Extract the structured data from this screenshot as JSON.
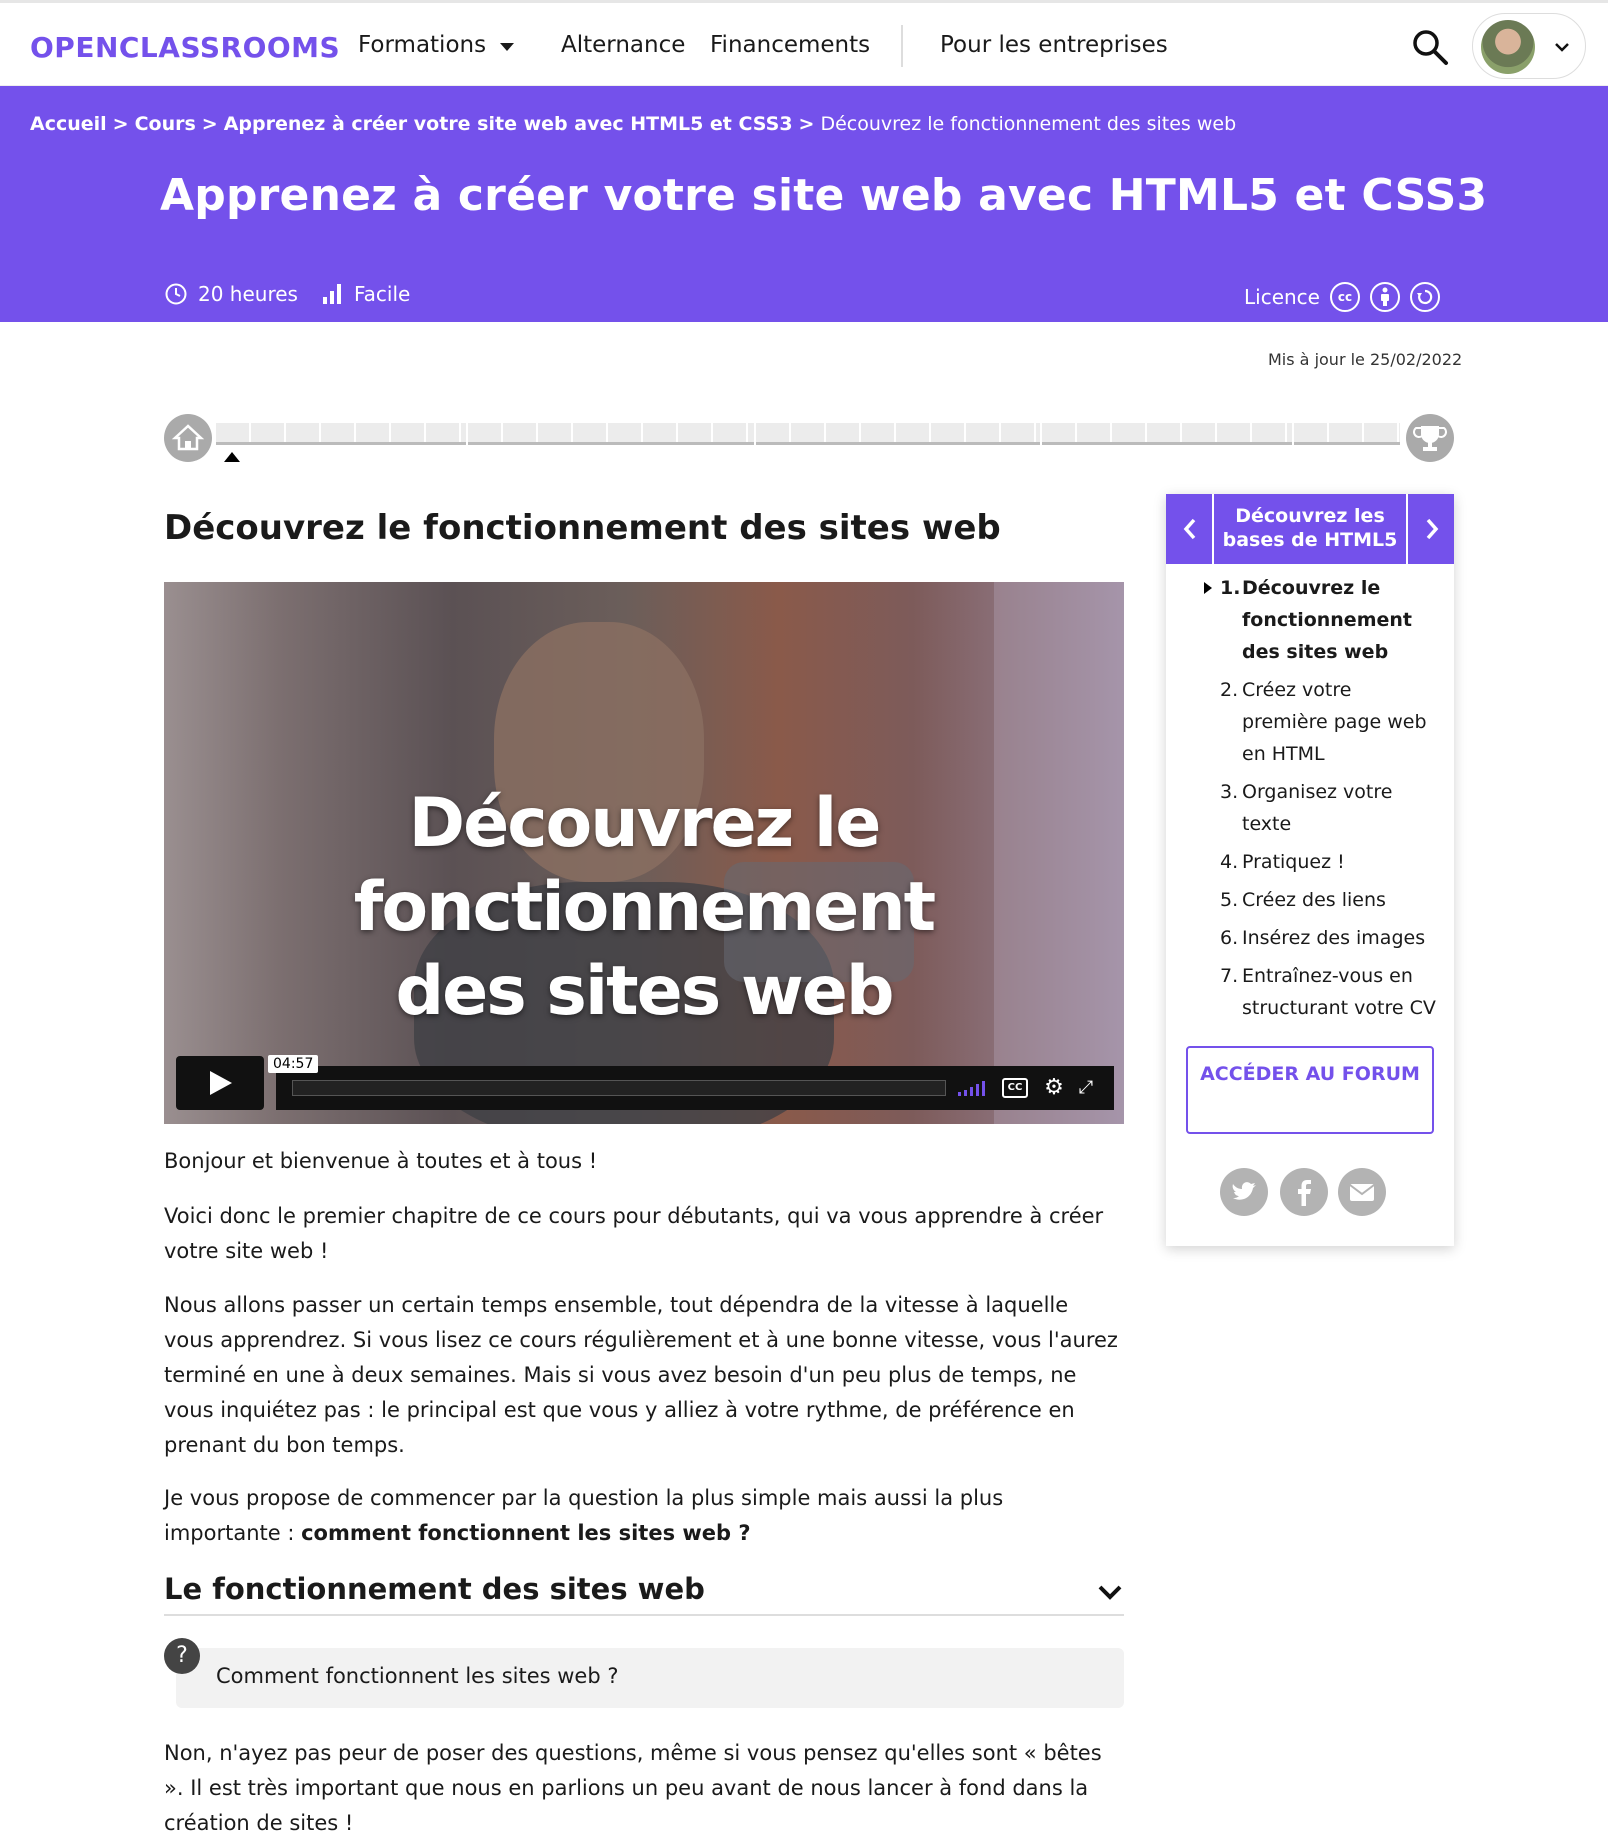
{
  "header": {
    "logo": "OPENCLASSROOMS",
    "nav": {
      "formations": "Formations",
      "alternance": "Alternance",
      "financements": "Financements",
      "entreprises": "Pour les entreprises"
    }
  },
  "hero": {
    "breadcrumb": {
      "home": "Accueil",
      "courses": "Cours",
      "course": "Apprenez à créer votre site web avec HTML5 et CSS3",
      "chapter": "Découvrez le fonctionnement des sites web",
      "separator": ">"
    },
    "title": "Apprenez à créer votre site web avec HTML5 et CSS3",
    "duration": "20 heures",
    "level": "Facile",
    "licence_label": "Licence",
    "licence_icons": [
      "cc",
      "by",
      "sa"
    ]
  },
  "updated": "Mis à jour le 25/02/2022",
  "progress": {
    "current_chapter_index": 0
  },
  "chapter": {
    "title": "Découvrez le fonctionnement des sites web",
    "video": {
      "overlay_title_line1": "Découvrez le fonctionnement",
      "overlay_title_line2": "des sites web",
      "duration": "04:57"
    },
    "paragraphs": {
      "p1": "Bonjour et bienvenue à toutes et à tous !",
      "p2": "Voici donc le premier chapitre de ce cours pour débutants, qui va vous apprendre à créer votre site web !",
      "p3": "Nous allons passer un certain temps ensemble, tout dépendra de la vitesse à laquelle vous apprendrez. Si vous lisez ce cours régulièrement et à une bonne vitesse, vous l'aurez terminé en une à deux semaines. Mais si vous avez besoin d'un peu plus de temps, ne vous inquiétez pas : le principal est que vous y alliez à votre rythme, de préférence en prenant du bon temps.",
      "p4_start": "Je vous propose de commencer par la question la plus simple mais aussi la plus importante : ",
      "p4_bold": "comment fonctionnent les sites web ?",
      "p5": "Non, n'ayez pas peur de poser des questions, même si vous pensez qu'elles sont « bêtes ». Il est très important que nous en parlions un peu avant de nous lancer à fond dans la création de sites !"
    },
    "section_title": "Le fonctionnement des sites web",
    "question_icon": "?",
    "question": "Comment fonctionnent les sites web ?"
  },
  "sidebar": {
    "part_title": "Découvrez les bases de HTML5",
    "items": [
      {
        "num": "1.",
        "label": "Découvrez le fonctionnement des sites web"
      },
      {
        "num": "2.",
        "label": "Créez votre première page web en HTML"
      },
      {
        "num": "3.",
        "label": "Organisez votre texte"
      },
      {
        "num": "4.",
        "label": "Pratiquez !"
      },
      {
        "num": "5.",
        "label": "Créez des liens"
      },
      {
        "num": "6.",
        "label": "Insérez des images"
      },
      {
        "num": "7.",
        "label": "Entraînez-vous en structurant votre CV"
      }
    ],
    "forum_button": "ACCÉDER AU FORUM",
    "share": [
      "twitter-icon",
      "facebook-icon",
      "mail-icon"
    ]
  },
  "colors": {
    "brand": "#7451eb"
  }
}
